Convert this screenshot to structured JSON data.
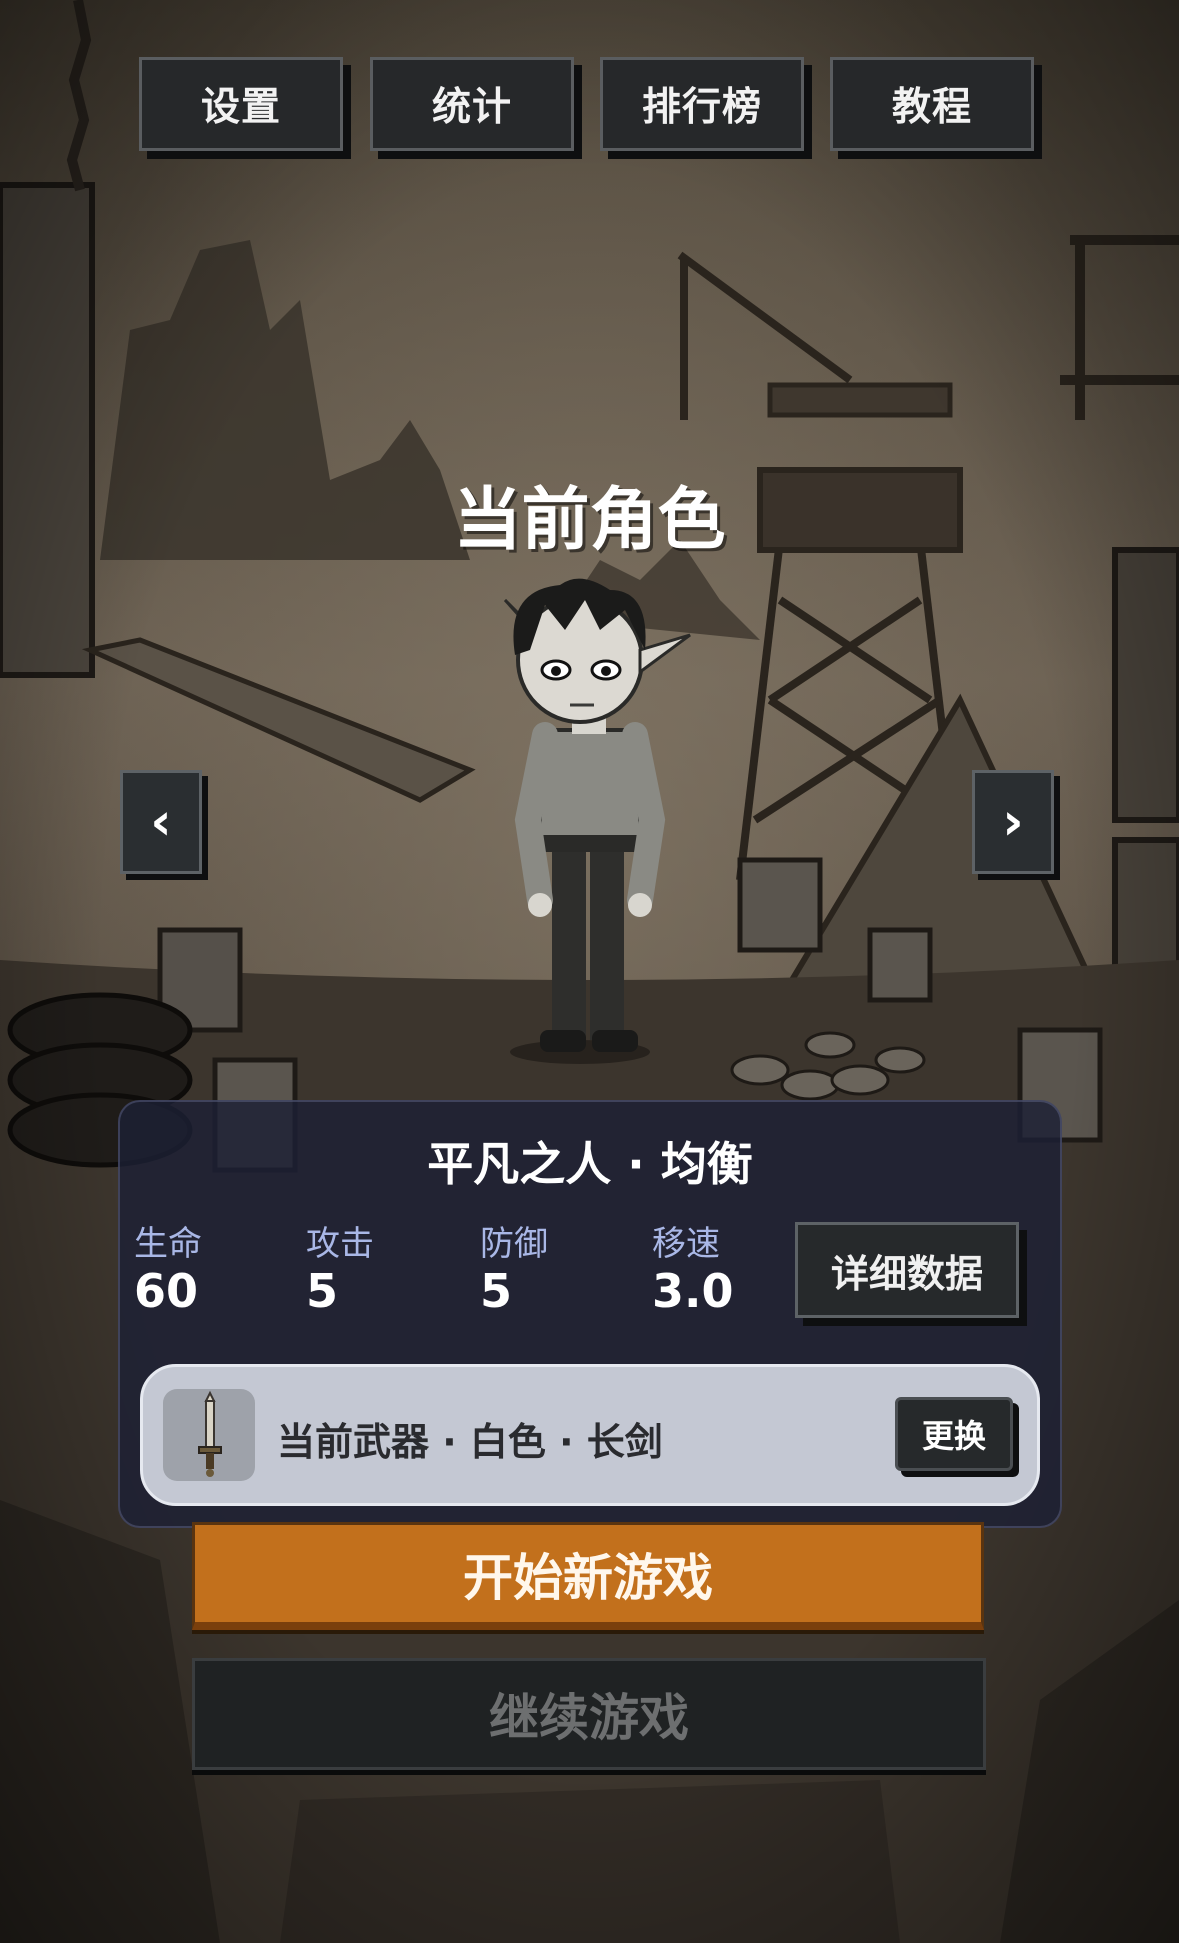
{
  "menu": {
    "settings": "设置",
    "stats": "统计",
    "leaderboard": "排行榜",
    "tutorial": "教程"
  },
  "title": "当前角色",
  "nav": {
    "prev": "‹",
    "next": "›"
  },
  "character": {
    "name": "平凡之人 · 均衡",
    "stats": [
      {
        "label": "生命",
        "value": "60"
      },
      {
        "label": "攻击",
        "value": "5"
      },
      {
        "label": "防御",
        "value": "5"
      },
      {
        "label": "移速",
        "value": "3.0"
      }
    ],
    "detail_button": "详细数据"
  },
  "weapon": {
    "text": "当前武器 · 白色 · 长剑",
    "icon": "sword-icon",
    "swap_button": "更换"
  },
  "actions": {
    "start": "开始新游戏",
    "continue": "继续游戏"
  },
  "colors": {
    "start_button": "#c2701c",
    "panel": "#1c2034",
    "weapon_bar": "#c4c8d3",
    "stat_label": "#a9b7e6"
  }
}
